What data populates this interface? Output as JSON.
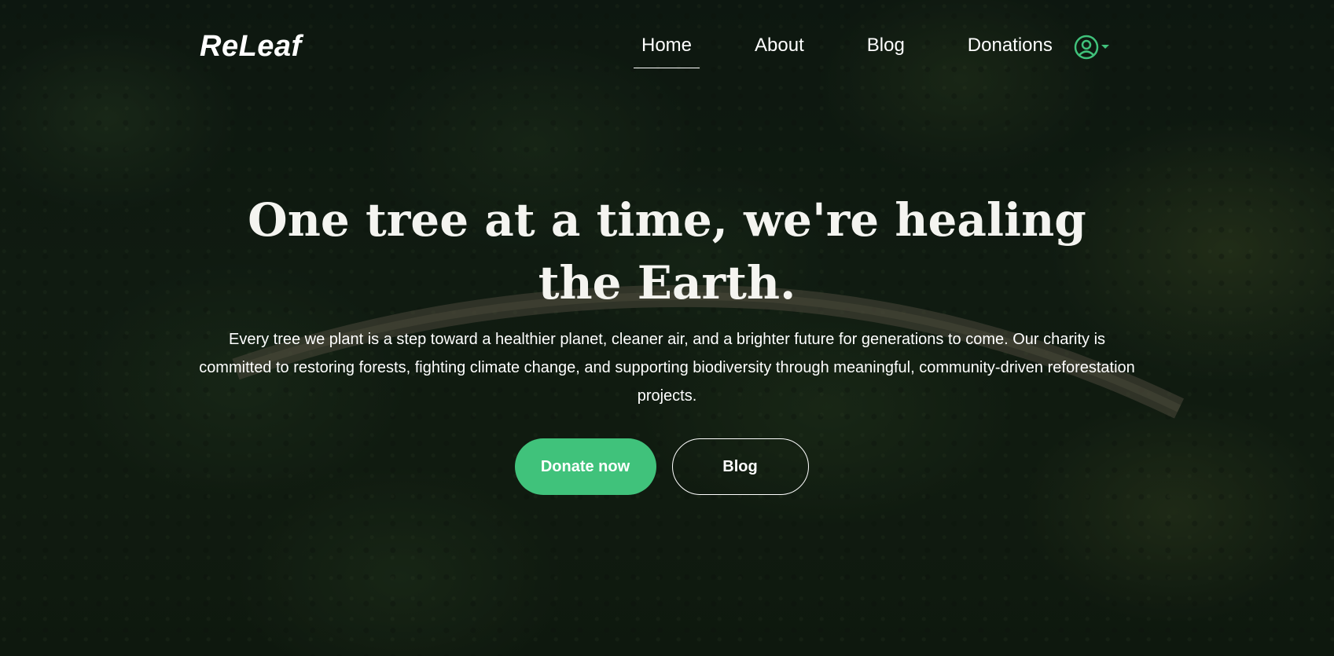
{
  "brand": {
    "name": "ReLeaf"
  },
  "nav": {
    "items": [
      {
        "label": "Home",
        "active": true
      },
      {
        "label": "About",
        "active": false
      },
      {
        "label": "Blog",
        "active": false
      },
      {
        "label": "Donations",
        "active": false
      }
    ],
    "user_icon": "user-circle-icon",
    "caret_icon": "caret-down-icon"
  },
  "hero": {
    "headline": "One tree at a time, we're healing the Earth.",
    "description": "Every tree we plant is a step toward a healthier planet, cleaner air, and a brighter future for generations to come. Our charity is committed to restoring forests, fighting climate change, and supporting biodiversity through meaningful, community-driven reforestation projects.",
    "primary_button": "Donate now",
    "secondary_button": "Blog"
  },
  "colors": {
    "accent": "#40c27b",
    "text": "#ffffff"
  }
}
